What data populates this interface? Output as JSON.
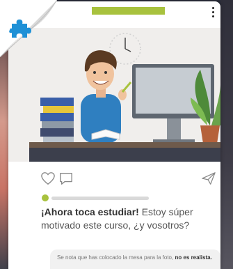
{
  "post": {
    "caption_bold": "¡Ahora toca estudiar!",
    "caption_text": " Estoy súper motivado este curso, ¿y vosotros?"
  },
  "comment": {
    "text": "Se nota que has colocado la mesa para la foto, ",
    "bold": "no es realista."
  },
  "progress": {
    "fraction": 0.0
  },
  "colors": {
    "accent_green": "#a8c23e",
    "puzzle_blue": "#1e90d6",
    "card_bg": "#ffffff"
  },
  "icons": [
    "more-vertical-icon",
    "puzzle-icon",
    "heart-icon",
    "comment-icon",
    "send-icon"
  ]
}
